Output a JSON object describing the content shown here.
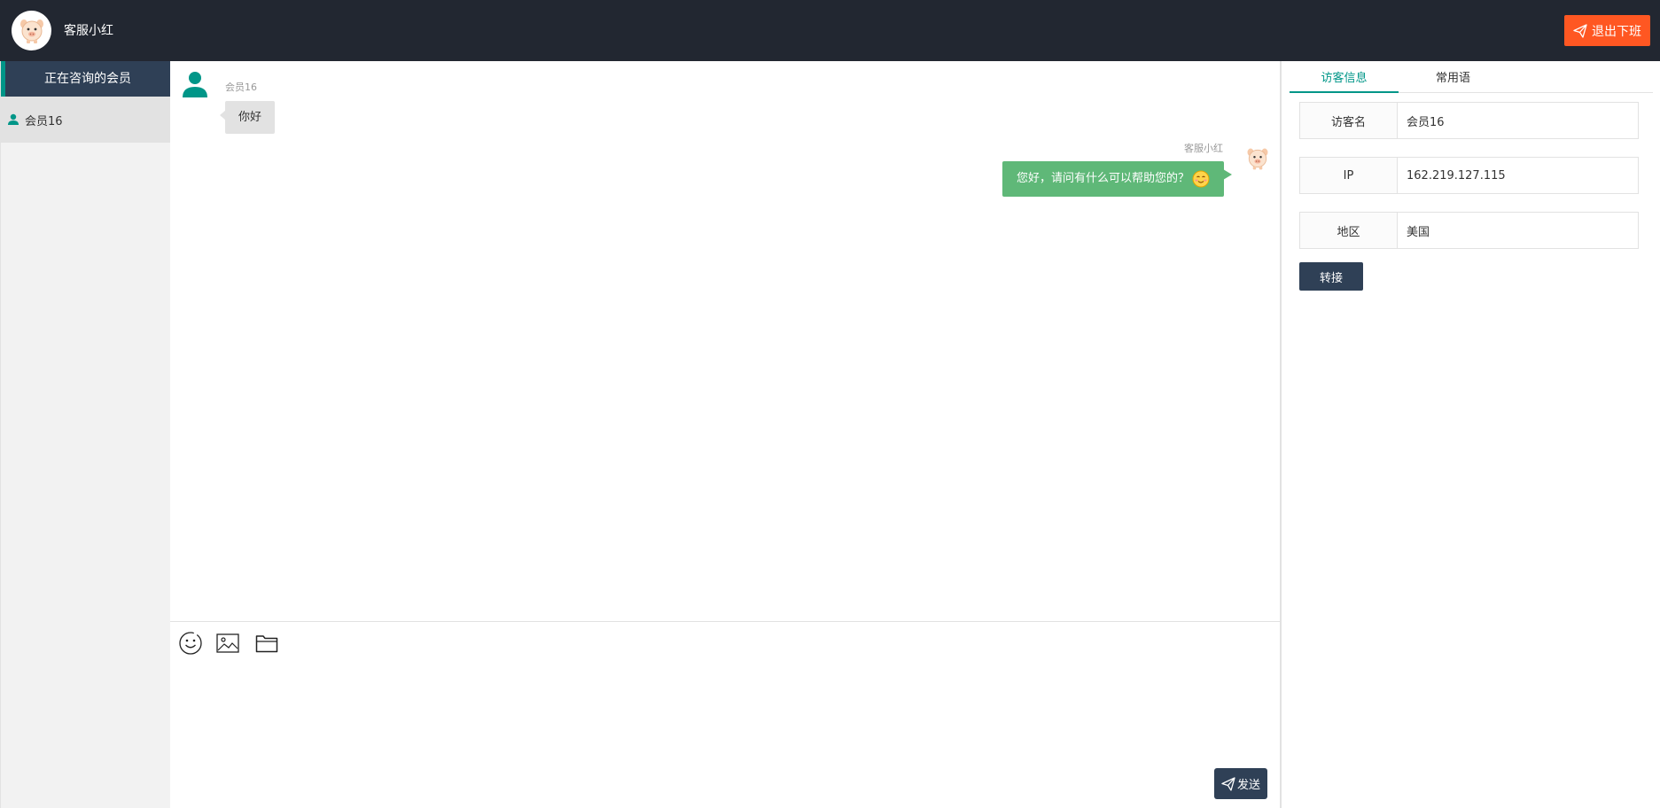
{
  "header": {
    "agent_name": "客服小红",
    "logout_label": "退出下班"
  },
  "sidebar": {
    "title": "正在咨询的会员",
    "items": [
      {
        "label": "会员16"
      }
    ]
  },
  "chat": {
    "messages": [
      {
        "sender": "会员16",
        "text": "你好",
        "side": "left"
      },
      {
        "sender": "客服小红",
        "text": "您好，请问有什么可以帮助您的？",
        "side": "right"
      }
    ],
    "tools": [
      "emoji-icon",
      "image-icon",
      "folder-icon"
    ],
    "send_label": "发送"
  },
  "panel": {
    "tabs": [
      {
        "label": "访客信息",
        "active": true
      },
      {
        "label": "常用语",
        "active": false
      }
    ],
    "info": [
      {
        "label": "访客名",
        "value": "会员16"
      },
      {
        "label": "IP",
        "value": "162.219.127.115"
      },
      {
        "label": "地区",
        "value": "美国"
      }
    ],
    "transfer_label": "转接"
  },
  "colors": {
    "header_bg": "#222731",
    "accent": "#009688",
    "logout": "#ff5722",
    "bubble_right": "#5fb878",
    "dark_button": "#2f4056"
  }
}
